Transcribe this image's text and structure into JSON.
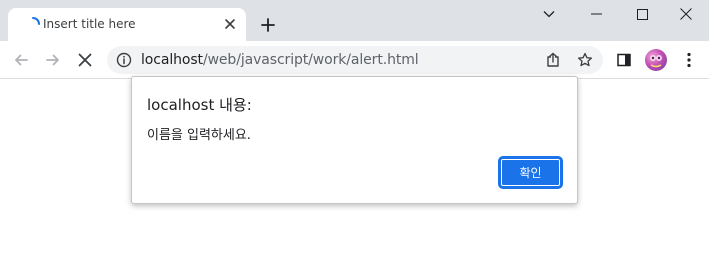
{
  "tab": {
    "title": "Insert title here",
    "favicon": "loading-spinner-icon",
    "close_icon": "close-icon"
  },
  "tabstrip": {
    "new_tab_icon": "plus-icon",
    "tab_search_icon": "chevron-down-icon",
    "minimize_icon": "minimize-icon",
    "maximize_icon": "maximize-icon",
    "window_close_icon": "close-icon"
  },
  "toolbar": {
    "back_icon": "back-arrow-icon",
    "forward_icon": "forward-arrow-icon",
    "stop_icon": "stop-loading-icon",
    "site_info_icon": "info-icon",
    "url_host": "localhost",
    "url_path": "/web/javascript/work/alert.html",
    "share_icon": "share-icon",
    "bookmark_icon": "star-icon",
    "side_panel_icon": "side-panel-icon",
    "profile_icon": "avatar",
    "menu_icon": "kebab-menu-icon"
  },
  "dialog": {
    "title": "localhost 내용:",
    "message": "이름을 입력하세요.",
    "ok_label": "확인"
  },
  "colors": {
    "tabstrip_bg": "#dee1e6",
    "omnibox_bg": "#f1f3f4",
    "accent": "#1a73e8",
    "text": "#202124",
    "text_secondary": "#5f6368"
  }
}
